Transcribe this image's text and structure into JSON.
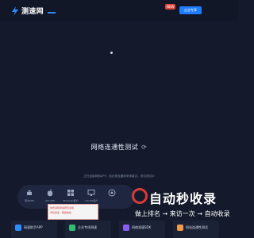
{
  "app": {
    "name": "测速网"
  },
  "header": {
    "badge": "NEW",
    "cta": "企业专享"
  },
  "main": {
    "title": "网络连通性测试",
    "description": "正在连接网络APP，若出现连通异常请重试，测试测试中"
  },
  "platforms": [
    {
      "label": "安卓APP",
      "icon": "android-icon"
    },
    {
      "label": "iOS APP",
      "icon": "apple-icon"
    },
    {
      "label": "Windows客户",
      "icon": "windows-icon"
    },
    {
      "label": "macOS客户",
      "icon": "monitor-icon"
    },
    {
      "label": "",
      "icon": "chrome-icon"
    }
  ],
  "ad": {
    "line1": "免费领取测速网专业版",
    "line2": "手机测速 · 网络体检"
  },
  "cards": [
    {
      "label": "网速助手APP",
      "color": "#2f8cff"
    },
    {
      "label": "企业专线测速",
      "color": "#2fbf71"
    },
    {
      "label": "网络测速SDK",
      "color": "#8a5cf6"
    },
    {
      "label": "网站连通性测试",
      "color": "#f2994a"
    }
  ],
  "watermark": {
    "title": "自动秒收录",
    "subtitle": "做上排名 → 来访一次 → 自动收录"
  },
  "colors": {
    "accent": "#1f7cff",
    "background": "#141a2b"
  }
}
